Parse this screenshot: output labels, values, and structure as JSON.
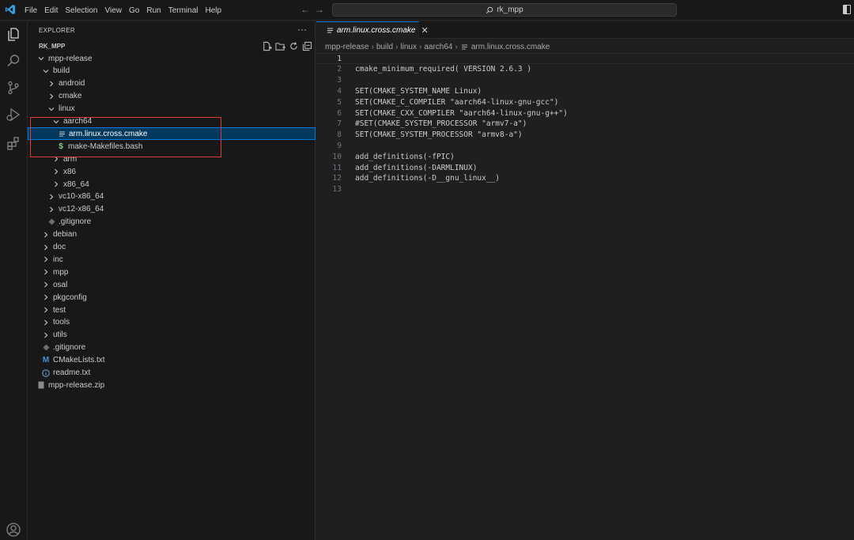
{
  "titlebar": {
    "menu": [
      "File",
      "Edit",
      "Selection",
      "View",
      "Go",
      "Run",
      "Terminal",
      "Help"
    ],
    "search_text": "rk_mpp",
    "back_icon": "arrow-left-icon",
    "forward_icon": "arrow-right-icon"
  },
  "activity_bar": {
    "items": [
      "explorer-icon",
      "search-icon",
      "source-control-icon",
      "run-debug-icon",
      "extensions-icon",
      "account-icon"
    ],
    "active": "explorer-icon",
    "accent_color": "#0078d4"
  },
  "sidebar": {
    "title": "EXPLORER",
    "more": "···",
    "workspace": "RK_MPP",
    "workspace_actions": [
      "new-file-icon",
      "new-folder-icon",
      "refresh-icon",
      "collapse-all-icon"
    ],
    "tree": [
      {
        "label": "mpp-release",
        "depth": 0,
        "kind": "folder",
        "expanded": true
      },
      {
        "label": "build",
        "depth": 1,
        "kind": "folder",
        "expanded": true
      },
      {
        "label": "android",
        "depth": 2,
        "kind": "folder",
        "expanded": false
      },
      {
        "label": "cmake",
        "depth": 2,
        "kind": "folder",
        "expanded": false
      },
      {
        "label": "linux",
        "depth": 2,
        "kind": "folder",
        "expanded": true
      },
      {
        "label": "aarch64",
        "depth": 3,
        "kind": "folder",
        "expanded": true
      },
      {
        "label": "arm.linux.cross.cmake",
        "depth": 4,
        "kind": "file",
        "icon": "lines-file-icon",
        "selected": true
      },
      {
        "label": "make-Makefiles.bash",
        "depth": 4,
        "kind": "file",
        "icon": "dollar-shell-icon"
      },
      {
        "label": "arm",
        "depth": 3,
        "kind": "folder",
        "expanded": false
      },
      {
        "label": "x86",
        "depth": 3,
        "kind": "folder",
        "expanded": false
      },
      {
        "label": "x86_64",
        "depth": 3,
        "kind": "folder",
        "expanded": false
      },
      {
        "label": "vc10-x86_64",
        "depth": 2,
        "kind": "folder",
        "expanded": false
      },
      {
        "label": "vc12-x86_64",
        "depth": 2,
        "kind": "folder",
        "expanded": false
      },
      {
        "label": ".gitignore",
        "depth": 2,
        "kind": "file",
        "icon": "git-diamond-icon"
      },
      {
        "label": "debian",
        "depth": 1,
        "kind": "folder",
        "expanded": false
      },
      {
        "label": "doc",
        "depth": 1,
        "kind": "folder",
        "expanded": false
      },
      {
        "label": "inc",
        "depth": 1,
        "kind": "folder",
        "expanded": false
      },
      {
        "label": "mpp",
        "depth": 1,
        "kind": "folder",
        "expanded": false
      },
      {
        "label": "osal",
        "depth": 1,
        "kind": "folder",
        "expanded": false
      },
      {
        "label": "pkgconfig",
        "depth": 1,
        "kind": "folder",
        "expanded": false
      },
      {
        "label": "test",
        "depth": 1,
        "kind": "folder",
        "expanded": false
      },
      {
        "label": "tools",
        "depth": 1,
        "kind": "folder",
        "expanded": false
      },
      {
        "label": "utils",
        "depth": 1,
        "kind": "folder",
        "expanded": false
      },
      {
        "label": ".gitignore",
        "depth": 1,
        "kind": "file",
        "icon": "git-diamond-icon"
      },
      {
        "label": "CMakeLists.txt",
        "depth": 1,
        "kind": "file",
        "icon": "m-cmake-icon"
      },
      {
        "label": "readme.txt",
        "depth": 1,
        "kind": "file",
        "icon": "info-icon"
      },
      {
        "label": "mpp-release.zip",
        "depth": 0,
        "kind": "file",
        "icon": "zip-file-icon"
      }
    ]
  },
  "editor": {
    "tab": {
      "label": "arm.linux.cross.cmake",
      "close": "✕"
    },
    "breadcrumb": [
      "mpp-release",
      "build",
      "linux",
      "aarch64",
      "arm.linux.cross.cmake"
    ],
    "current_line": 1,
    "lines": [
      "",
      "cmake_minimum_required( VERSION 2.6.3 )",
      "",
      "SET(CMAKE_SYSTEM_NAME Linux)",
      "SET(CMAKE_C_COMPILER \"aarch64-linux-gnu-gcc\")",
      "SET(CMAKE_CXX_COMPILER \"aarch64-linux-gnu-g++\")",
      "#SET(CMAKE_SYSTEM_PROCESSOR \"armv7-a\")",
      "SET(CMAKE_SYSTEM_PROCESSOR \"armv8-a\")",
      "",
      "add_definitions(-fPIC)",
      "add_definitions(-DARMLINUX)",
      "add_definitions(-D__gnu_linux__)",
      ""
    ]
  },
  "colors": {
    "selection_bg": "#04395e",
    "annotation_box": "#e03a3a",
    "shell_icon": "#89d185",
    "cmake_icon": "#4a90d9"
  }
}
